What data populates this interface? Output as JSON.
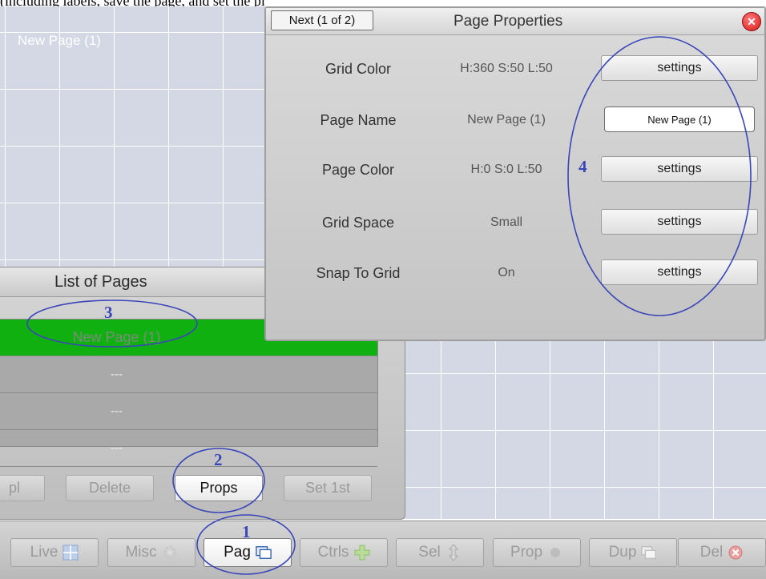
{
  "caption": "(including labels, save the page, and set the pixel size)",
  "canvas": {
    "page_title": "New Page (1)"
  },
  "list_panel": {
    "title": "List of Pages",
    "rows": [
      "New Page (1)",
      "---",
      "---",
      "---"
    ],
    "buttons": {
      "dupl": "pl",
      "delete": "Delete",
      "props": "Props",
      "set_first": "Set 1st"
    }
  },
  "props_dialog": {
    "next_label": "Next (1 of 2)",
    "title": "Page Properties",
    "rows": [
      {
        "label": "Grid Color",
        "value": "H:360 S:50 L:50",
        "button": "settings"
      },
      {
        "label": "Page Name",
        "value": "New Page (1)",
        "input": "New Page (1)"
      },
      {
        "label": "Page Color",
        "value": "H:0 S:0 L:50",
        "button": "settings"
      },
      {
        "label": "Grid Space",
        "value": "Small",
        "button": "settings"
      },
      {
        "label": "Snap To Grid",
        "value": "On",
        "button": "settings"
      }
    ]
  },
  "toolbar": {
    "buttons": [
      {
        "label": "Live",
        "icon": "grid-icon"
      },
      {
        "label": "Misc",
        "icon": "gear-icon"
      },
      {
        "label": "Pag",
        "icon": "pages-icon"
      },
      {
        "label": "Ctrls",
        "icon": "plus-icon"
      },
      {
        "label": "Sel",
        "icon": "arrows-icon"
      },
      {
        "label": "Prop",
        "icon": "dot-icon"
      },
      {
        "label": "Dup",
        "icon": "duplicate-icon"
      },
      {
        "label": "Del",
        "icon": "delete-icon"
      }
    ]
  },
  "annotations": [
    "1",
    "2",
    "3",
    "4"
  ],
  "colors": {
    "selected_row": "#11b011",
    "annotation": "#3a46b8",
    "close": "#d81818"
  }
}
